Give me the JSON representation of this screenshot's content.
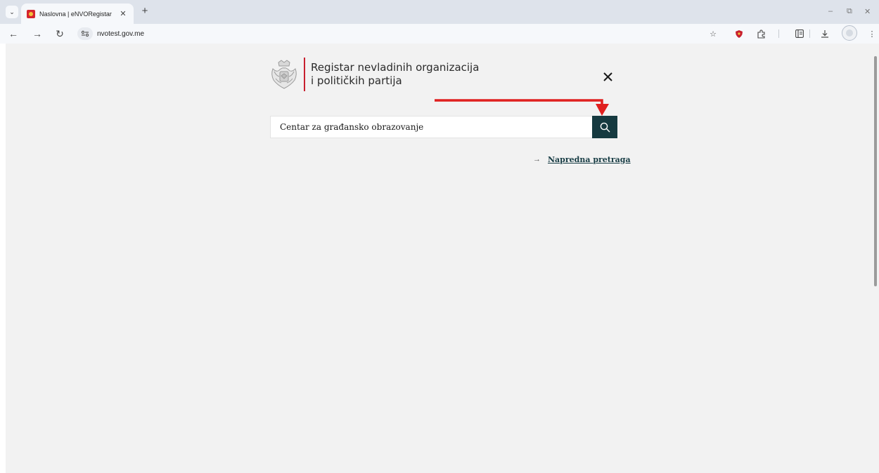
{
  "browser": {
    "tab_title": "Naslovna | eNVORegistar",
    "url": "nvotest.gov.me"
  },
  "page": {
    "logo_line1": "Registar nevladinih organizacija",
    "logo_line2": "i političkih partija",
    "search": {
      "value": "Centar za građansko obrazovanje"
    },
    "advanced_search_label": "Napredna pretraga"
  },
  "colors": {
    "search_button": "#163a40",
    "annotation_arrow": "#e0201f",
    "logo_divider": "#c8202f",
    "page_background": "#f2f2f2"
  }
}
